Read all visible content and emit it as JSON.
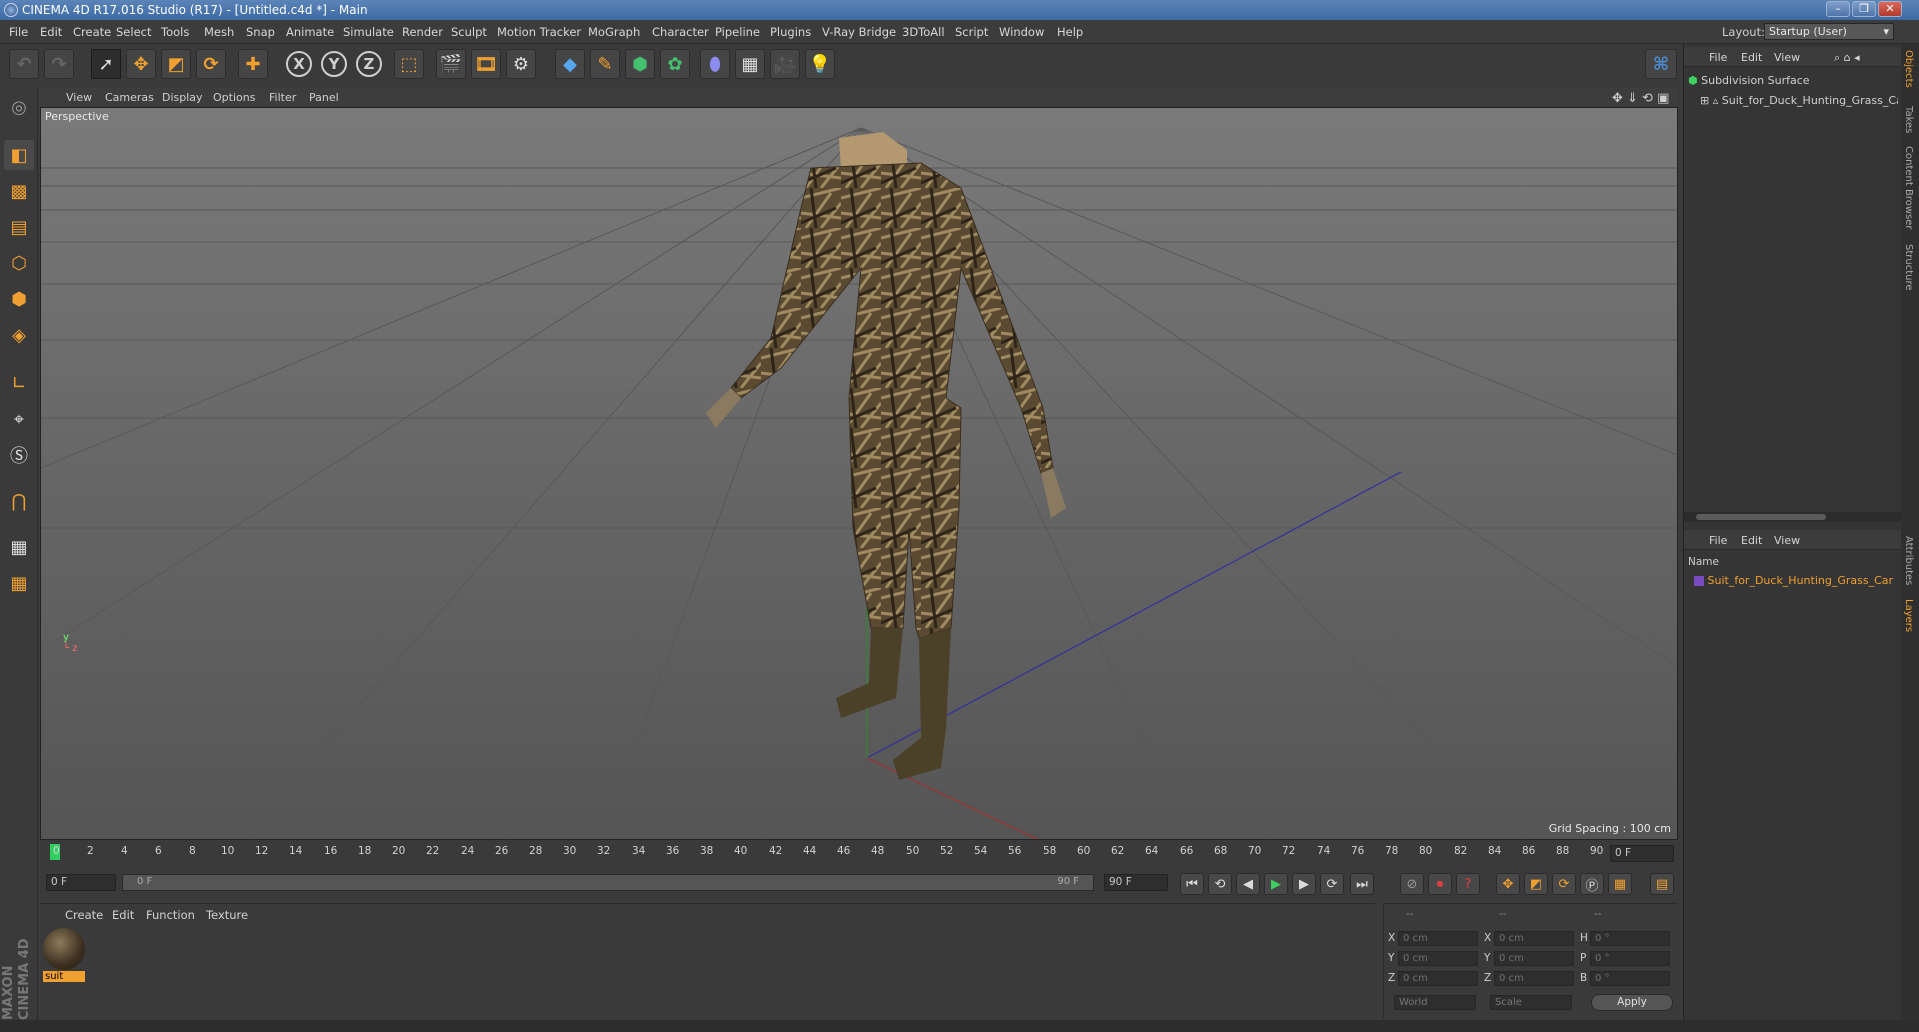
{
  "window": {
    "title": "CINEMA 4D R17.016 Studio (R17) - [Untitled.c4d *] - Main",
    "controls": [
      "–",
      "❐",
      "✕"
    ]
  },
  "menu": {
    "items": [
      "File",
      "Edit",
      "Create",
      "Select",
      "Tools",
      "Mesh",
      "Snap",
      "Animate",
      "Simulate",
      "Render",
      "Sculpt",
      "Motion Tracker",
      "MoGraph",
      "Character",
      "Pipeline",
      "Plugins",
      "V-Ray Bridge",
      "3DToAll",
      "Script",
      "Window",
      "Help"
    ],
    "layout_label": "Layout:",
    "layout_value": "Startup (User)"
  },
  "toolbar": {
    "icons": [
      "undo-icon",
      "redo-icon",
      "live-selection-icon",
      "move-icon",
      "scale-icon",
      "rotate-icon",
      "add-object-icon",
      "x-axis-lock",
      "y-axis-lock",
      "z-axis-lock",
      "coordinate-system-icon",
      "render-view-icon",
      "render-picture-viewer-icon",
      "render-settings-icon",
      "cube-primitive-icon",
      "spline-pen-icon",
      "subdivision-nurbs-icon",
      "cloner-icon",
      "deformer-icon",
      "floor-icon",
      "camera-icon",
      "light-icon"
    ],
    "axis_labels": [
      "X",
      "Y",
      "Z"
    ],
    "accent": "#f0a030"
  },
  "viewport": {
    "menu": [
      "View",
      "Cameras",
      "Display",
      "Options",
      "Filter",
      "Panel"
    ],
    "label": "Perspective",
    "grid_spacing": "Grid Spacing : 100 cm"
  },
  "timeline": {
    "ticks": [
      "0",
      "2",
      "4",
      "6",
      "8",
      "10",
      "12",
      "14",
      "16",
      "18",
      "20",
      "22",
      "24",
      "26",
      "28",
      "30",
      "32",
      "34",
      "36",
      "38",
      "40",
      "42",
      "44",
      "46",
      "48",
      "50",
      "52",
      "54",
      "56",
      "58",
      "60",
      "62",
      "64",
      "66",
      "68",
      "70",
      "72",
      "74",
      "76",
      "78",
      "80",
      "82",
      "84",
      "86",
      "88",
      "90"
    ],
    "current_frame": "0 F"
  },
  "transport": {
    "start_field": "0 F",
    "range_start": "0 F",
    "range_end": "90 F",
    "end_field": "90 F"
  },
  "materials": {
    "menu": [
      "Create",
      "Edit",
      "Function",
      "Texture"
    ],
    "items": [
      {
        "name": "suit"
      }
    ]
  },
  "coordinates": {
    "header": [
      "--",
      "--",
      "--"
    ],
    "rows": [
      {
        "a_label": "X",
        "a_val": "0 cm",
        "b_label": "X",
        "b_val": "0 cm",
        "c_label": "H",
        "c_val": "0 °"
      },
      {
        "a_label": "Y",
        "a_val": "0 cm",
        "b_label": "Y",
        "b_val": "0 cm",
        "c_label": "P",
        "c_val": "0 °"
      },
      {
        "a_label": "Z",
        "a_val": "0 cm",
        "b_label": "Z",
        "b_val": "0 cm",
        "c_label": "B",
        "c_val": "0 °"
      }
    ],
    "mode1": "World",
    "mode2": "Scale",
    "apply": "Apply"
  },
  "objects_panel": {
    "menu": [
      "File",
      "Edit",
      "View"
    ],
    "tree": [
      {
        "name": "Subdivision Surface"
      },
      {
        "name": "Suit_for_Duck_Hunting_Grass_Ca"
      }
    ]
  },
  "layers_panel": {
    "menu": [
      "File",
      "Edit",
      "View"
    ],
    "column": "Name",
    "items": [
      {
        "name": "Suit_for_Duck_Hunting_Grass_Car"
      }
    ]
  },
  "side_tabs": [
    "Objects",
    "Takes",
    "Content Browser",
    "Structure",
    "Attributes",
    "Layers"
  ],
  "branding": "MAXON CINEMA 4D"
}
